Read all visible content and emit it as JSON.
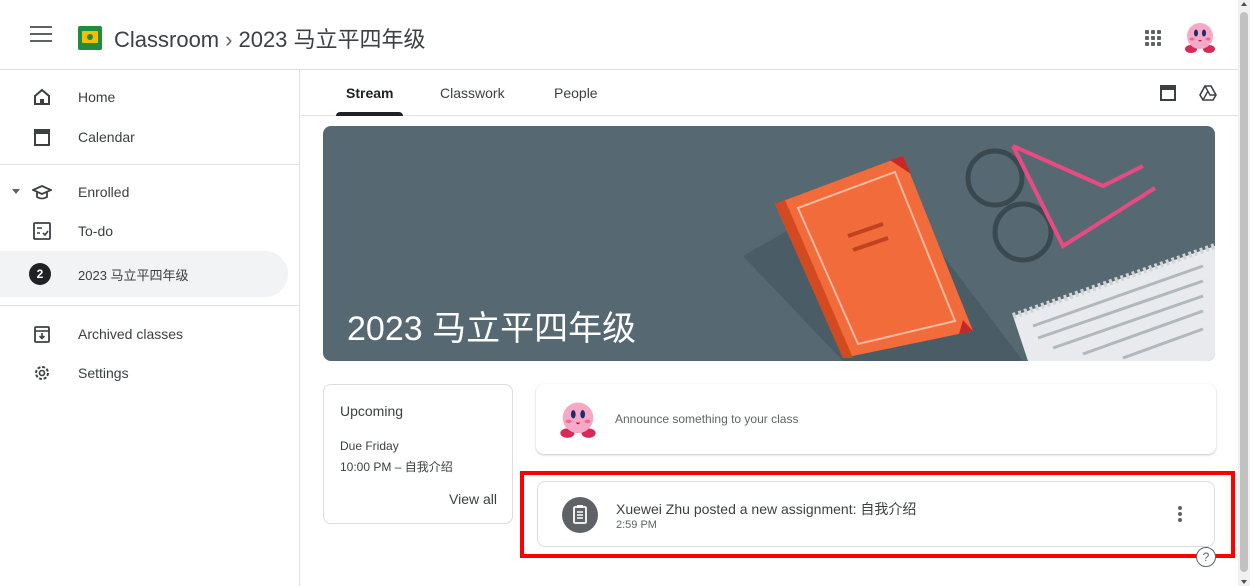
{
  "header": {
    "app_name": "Classroom",
    "separator": "›",
    "class_name": "2023 马立平四年级"
  },
  "sidebar": {
    "home": "Home",
    "calendar": "Calendar",
    "enrolled": "Enrolled",
    "todo": "To-do",
    "class_badge": "2",
    "class_item": "2023 马立平四年级",
    "archived": "Archived classes",
    "settings": "Settings"
  },
  "tabs": [
    {
      "label": "Stream"
    },
    {
      "label": "Classwork"
    },
    {
      "label": "People"
    }
  ],
  "banner": {
    "title": "2023 马立平四年级"
  },
  "upcoming": {
    "heading": "Upcoming",
    "due": "Due Friday",
    "item": "10:00 PM – 自我介绍",
    "view_all": "View all"
  },
  "announce": {
    "placeholder": "Announce something to your class"
  },
  "post": {
    "title": "Xuewei Zhu posted a new assignment: 自我介绍",
    "time": "2:59 PM"
  },
  "help": {
    "label": "?"
  },
  "colors": {
    "banner": "#566973",
    "highlight": "#ff0000",
    "logo_green": "#1e8e3e",
    "logo_yellow": "#fbbc04",
    "book_orange": "#f26b3a",
    "glasses_pink": "#e94a82"
  }
}
